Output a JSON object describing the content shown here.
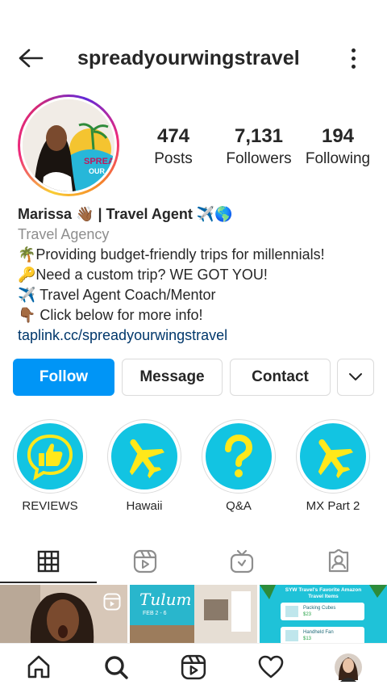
{
  "header": {
    "username": "spreadyourwingstravel",
    "back_icon": "arrow-left-icon",
    "menu_icon": "more-vertical-icon"
  },
  "profile": {
    "avatar_icon": "profile-photo",
    "stats": [
      {
        "value": "474",
        "label": "Posts"
      },
      {
        "value": "7,131",
        "label": "Followers"
      },
      {
        "value": "194",
        "label": "Following"
      }
    ]
  },
  "bio": {
    "name": "Marissa 👋🏾 | Travel Agent ✈️🌎",
    "category": "Travel Agency",
    "lines": [
      "🌴Providing budget-friendly trips for millennials!",
      "🔑Need a custom trip? WE GOT YOU!",
      "✈️ Travel Agent Coach/Mentor",
      "👇🏾 Click below for more info!"
    ],
    "link": "taplink.cc/spreadyourwingstravel"
  },
  "actions": {
    "follow": "Follow",
    "message": "Message",
    "contact": "Contact",
    "more_icon": "chevron-down-icon"
  },
  "highlights": [
    {
      "label": "REVIEWS",
      "icon": "thumbs-up-icon"
    },
    {
      "label": "Hawaii",
      "icon": "airplane-icon"
    },
    {
      "label": "Q&A",
      "icon": "question-mark-icon"
    },
    {
      "label": "MX Part 2",
      "icon": "airplane-icon"
    }
  ],
  "tabs": [
    {
      "name": "grid",
      "icon": "grid-icon",
      "active": true
    },
    {
      "name": "reels",
      "icon": "reels-icon",
      "active": false
    },
    {
      "name": "igtv",
      "icon": "igtv-icon",
      "active": false
    },
    {
      "name": "tagged",
      "icon": "tagged-icon",
      "active": false
    }
  ],
  "posts": [
    {
      "type": "reel-thumbnail"
    },
    {
      "type": "video-thumbnail",
      "title": "Tulum",
      "subtitle": "FEB 2 - 6"
    },
    {
      "type": "image-thumbnail",
      "title": "SYW Travel's Favorite Amazon Travel Items",
      "items": [
        {
          "name": "Packing Cubes",
          "price": "$23"
        },
        {
          "name": "Handheld Fan",
          "price": "$13"
        }
      ]
    }
  ],
  "bottom_nav": [
    {
      "icon": "home-icon"
    },
    {
      "icon": "search-icon"
    },
    {
      "icon": "reels-icon"
    },
    {
      "icon": "heart-icon"
    },
    {
      "icon": "profile-avatar-icon"
    }
  ],
  "colors": {
    "accent": "#0095f6",
    "highlight_fill": "#12c4e2",
    "highlight_glyph": "#ffe81a",
    "link": "#00376b",
    "muted": "#8e8e8e"
  }
}
